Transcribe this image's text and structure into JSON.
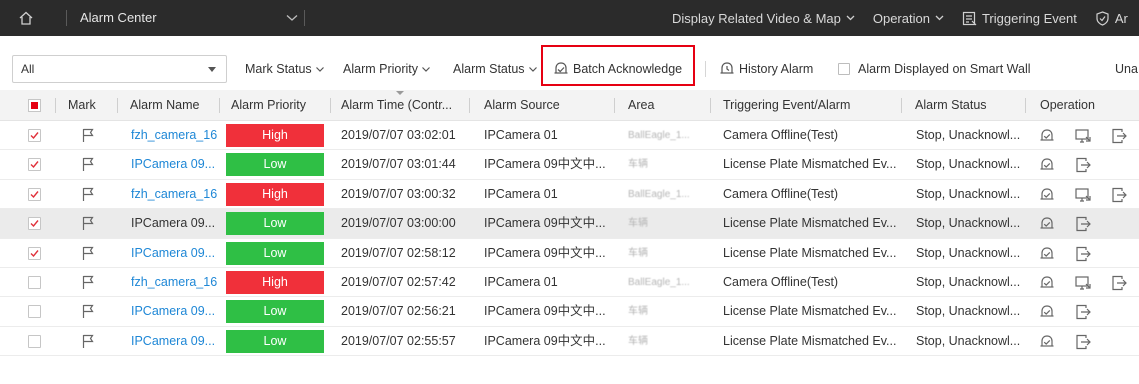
{
  "titlebar": {
    "title": "Alarm Center",
    "display_related": "Display Related Video & Map",
    "operation": "Operation",
    "triggering_event": "Triggering Event",
    "truncated_item": "Ar"
  },
  "toolbar": {
    "filter_value": "All",
    "mark_status": "Mark Status",
    "alarm_priority": "Alarm Priority",
    "alarm_status": "Alarm Status",
    "batch_acknowledge": "Batch Acknowledge",
    "history_alarm": "History Alarm",
    "alarm_on_smart_wall": "Alarm Displayed on Smart Wall",
    "truncated_item": "Una"
  },
  "table": {
    "headers": {
      "mark": "Mark",
      "alarm_name": "Alarm Name",
      "alarm_priority": "Alarm Priority",
      "alarm_time": "Alarm Time (Contr...",
      "alarm_source": "Alarm Source",
      "area": "Area",
      "triggering_event": "Triggering Event/Alarm",
      "alarm_status": "Alarm Status",
      "operation": "Operation"
    },
    "rows": [
      {
        "checked": true,
        "name": "fzh_camera_16",
        "priority": "High",
        "time": "2019/07/07 03:02:01",
        "source": "IPCamera 01",
        "area": "BallEagle_1...",
        "event": "Camera Offline(Test)",
        "status": "Stop, Unacknowl...",
        "ops": 3,
        "highlight": false
      },
      {
        "checked": true,
        "name": "IPCamera 09...",
        "priority": "Low",
        "time": "2019/07/07 03:01:44",
        "source": "IPCamera 09中文中...",
        "area": "车辆",
        "event": "License Plate Mismatched Ev...",
        "status": "Stop, Unacknowl...",
        "ops": 2,
        "highlight": false
      },
      {
        "checked": true,
        "name": "fzh_camera_16",
        "priority": "High",
        "time": "2019/07/07 03:00:32",
        "source": "IPCamera 01",
        "area": "BallEagle_1...",
        "event": "Camera Offline(Test)",
        "status": "Stop, Unacknowl...",
        "ops": 3,
        "highlight": false
      },
      {
        "checked": true,
        "name": "IPCamera 09...",
        "priority": "Low",
        "time": "2019/07/07 03:00:00",
        "source": "IPCamera 09中文中...",
        "area": "车辆",
        "event": "License Plate Mismatched Ev...",
        "status": "Stop, Unacknowl...",
        "ops": 2,
        "highlight": true
      },
      {
        "checked": true,
        "name": "IPCamera 09...",
        "priority": "Low",
        "time": "2019/07/07 02:58:12",
        "source": "IPCamera 09中文中...",
        "area": "车辆",
        "event": "License Plate Mismatched Ev...",
        "status": "Stop, Unacknowl...",
        "ops": 2,
        "highlight": false
      },
      {
        "checked": false,
        "name": "fzh_camera_16",
        "priority": "High",
        "time": "2019/07/07 02:57:42",
        "source": "IPCamera 01",
        "area": "BallEagle_1...",
        "event": "Camera Offline(Test)",
        "status": "Stop, Unacknowl...",
        "ops": 3,
        "highlight": false
      },
      {
        "checked": false,
        "name": "IPCamera 09...",
        "priority": "Low",
        "time": "2019/07/07 02:56:21",
        "source": "IPCamera 09中文中...",
        "area": "车辆",
        "event": "License Plate Mismatched Ev...",
        "status": "Stop, Unacknowl...",
        "ops": 2,
        "highlight": false
      },
      {
        "checked": false,
        "name": "IPCamera 09...",
        "priority": "Low",
        "time": "2019/07/07 02:55:57",
        "source": "IPCamera 09中文中...",
        "area": "车辆",
        "event": "License Plate Mismatched Ev...",
        "status": "Stop, Unacknowl...",
        "ops": 2,
        "highlight": false
      }
    ]
  },
  "colors": {
    "high": "#f0303a",
    "low": "#2fbf45",
    "link": "#1e87d6",
    "highlight_box": "#e60012",
    "titlebar_bg": "#2b2b2b"
  },
  "icons": {
    "home": "home-icon",
    "flag": "flag-icon",
    "acknowledge": "acknowledge-icon",
    "smart_wall": "smart-wall-icon",
    "export": "export-icon",
    "history": "history-icon",
    "triggering": "triggering-event-icon",
    "shield": "shield-icon"
  }
}
